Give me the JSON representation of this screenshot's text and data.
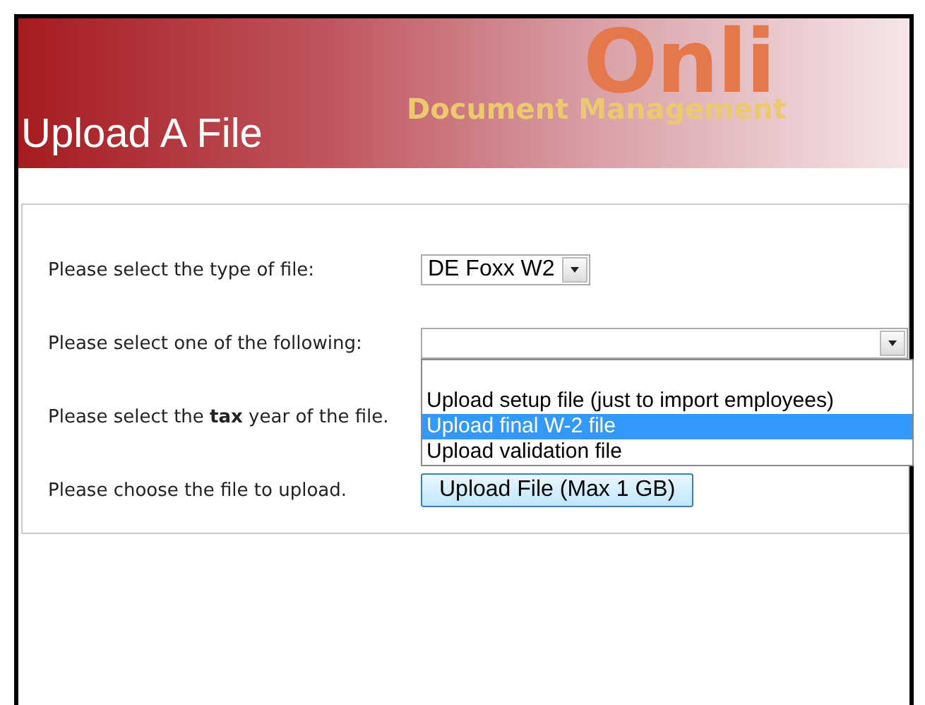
{
  "header": {
    "title": "Upload A File",
    "logo": {
      "word": "Onli",
      "tagline": "Document Management"
    }
  },
  "form": {
    "rows": [
      {
        "kind": "select",
        "label": "Please select the type of file:",
        "value": "DE Foxx W2"
      },
      {
        "kind": "open-select",
        "label": "Please select one of the following:",
        "options": [
          {
            "label": "Upload setup file (just to import employees)",
            "selected": false
          },
          {
            "label": "Upload final W-2 file",
            "selected": true
          },
          {
            "label": "Upload validation file",
            "selected": false
          }
        ]
      },
      {
        "kind": "text",
        "label": "Please select the **tax** year of the file."
      },
      {
        "kind": "button",
        "label": "Please choose the file to upload.",
        "button": "Upload File (Max 1 GB)"
      }
    ]
  }
}
